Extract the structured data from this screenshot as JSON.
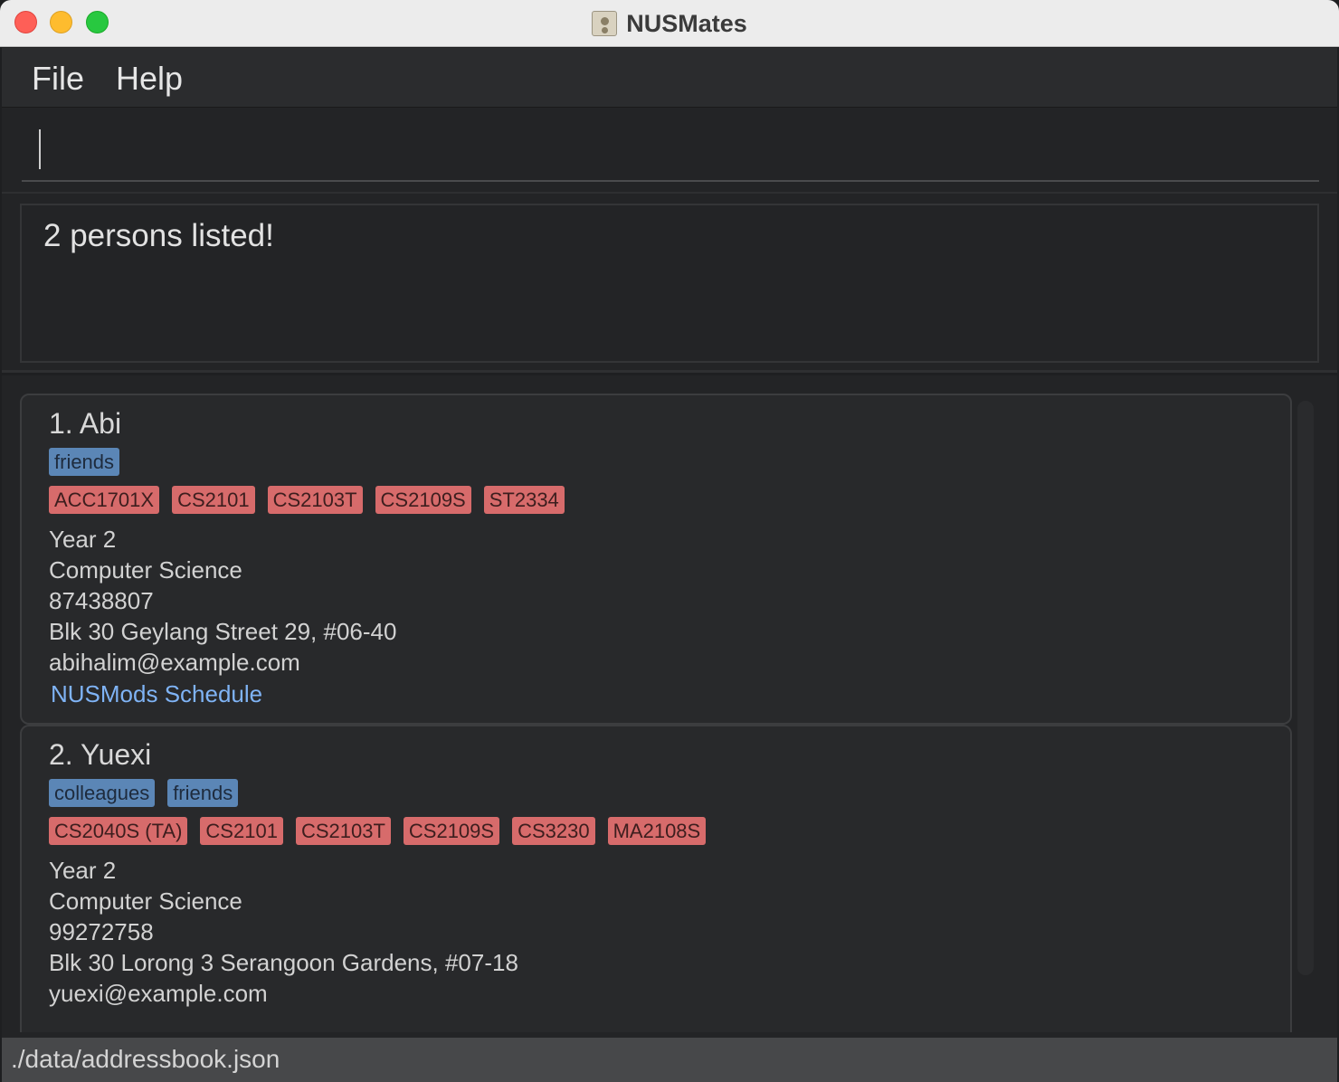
{
  "window": {
    "title": "NUSMates"
  },
  "menu": {
    "items": [
      {
        "label": "File"
      },
      {
        "label": "Help"
      }
    ]
  },
  "command": {
    "value": ""
  },
  "result": {
    "message": "2 persons listed!"
  },
  "persons": [
    {
      "name": "1. Abi",
      "tags": [
        "friends"
      ],
      "modules": [
        "ACC1701X",
        "CS2101",
        "CS2103T",
        "CS2109S",
        "ST2334"
      ],
      "year": "Year 2",
      "major": "Computer Science",
      "phone": "87438807",
      "address": "Blk 30 Geylang Street 29, #06-40",
      "email": "abihalim@example.com",
      "schedule_link": "NUSMods Schedule"
    },
    {
      "name": "2. Yuexi",
      "tags": [
        "colleagues",
        "friends"
      ],
      "modules": [
        "CS2040S (TA)",
        "CS2101",
        "CS2103T",
        "CS2109S",
        "CS3230",
        "MA2108S"
      ],
      "year": "Year 2",
      "major": "Computer Science",
      "phone": "99272758",
      "address": "Blk 30 Lorong 3 Serangoon Gardens, #07-18",
      "email": "yuexi@example.com"
    }
  ],
  "status": {
    "file_path": "./data/addressbook.json"
  },
  "colors": {
    "tag_blue": "#5b86b6",
    "module_red": "#d76b6b",
    "link": "#7fb3f5"
  }
}
